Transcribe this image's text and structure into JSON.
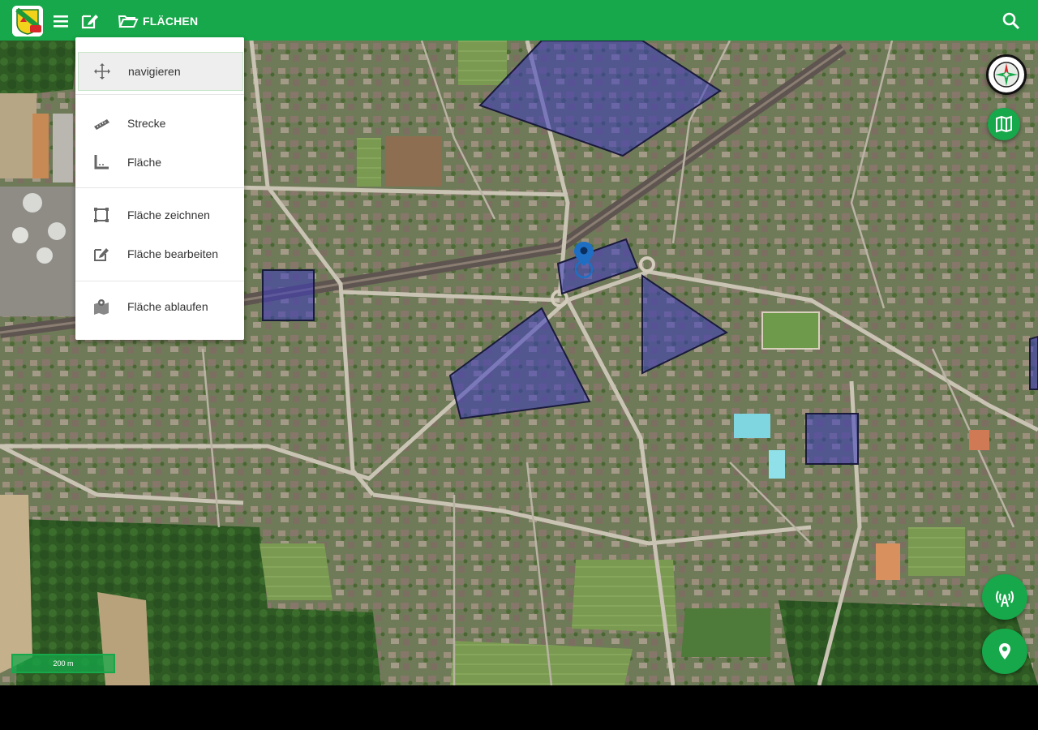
{
  "app": {
    "section_label": "FLÄCHEN",
    "accent_color": "#16a84a"
  },
  "toolbar": {
    "logo_icon": "municipality-logo",
    "menu_icon": "hamburger-icon",
    "edit_icon": "edit-icon",
    "folder_icon": "folder-open-icon",
    "search_icon": "search-icon"
  },
  "mode_menu": {
    "items": [
      {
        "label": "navigieren",
        "icon": "move-arrows-icon",
        "selected": true
      },
      {
        "label": "Strecke",
        "icon": "ruler-icon"
      },
      {
        "label": "Fläche",
        "icon": "area-corner-icon"
      },
      {
        "label": "Fläche zeichnen",
        "icon": "draw-area-icon"
      },
      {
        "label": "Fläche bearbeiten",
        "icon": "edit-area-icon"
      },
      {
        "label": "Fläche ablaufen",
        "icon": "walk-area-icon"
      }
    ]
  },
  "map": {
    "area_fill_color": "#3b3bbf",
    "scale_label": "200 m",
    "polygon_count": 7
  },
  "controls": {
    "compass_icon": "compass-icon",
    "layers_icon": "map-layers-icon",
    "gps_tracking_icon": "gps-antenna-icon",
    "locate_icon": "location-pin-icon"
  }
}
